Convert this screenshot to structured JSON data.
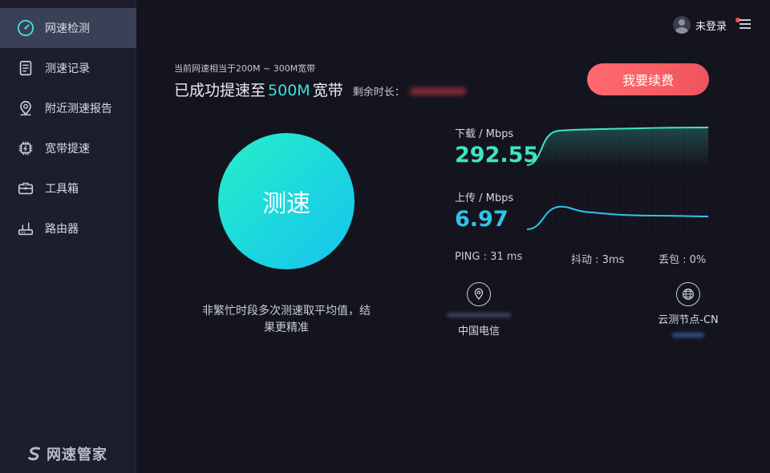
{
  "sidebar": {
    "items": [
      {
        "label": "网速检测",
        "icon": "speedometer-icon",
        "active": true
      },
      {
        "label": "测速记录",
        "icon": "document-icon"
      },
      {
        "label": "附近测速报告",
        "icon": "location-pin-icon"
      },
      {
        "label": "宽带提速",
        "icon": "chip-icon"
      },
      {
        "label": "工具箱",
        "icon": "toolbox-icon"
      },
      {
        "label": "路由器",
        "icon": "router-icon"
      }
    ],
    "brand": "网速管家"
  },
  "header": {
    "user_label": "未登录",
    "menu_icon": "hamburger-menu-icon"
  },
  "info": {
    "current_speed_text": "当前网速相当于200M ~ 300M宽带",
    "headline_prefix": "已成功提速至",
    "headline_highlight": "500M",
    "headline_suffix": "宽带",
    "remaining_label": "剩余时长："
  },
  "renew_button": "我要续费",
  "speed_test_button": "测速",
  "tip": "非繁忙时段多次测速取平均值，结果更精准",
  "download": {
    "label": "下载 / Mbps",
    "value": "292.55",
    "color": "#3de6c0"
  },
  "upload": {
    "label": "上传 / Mbps",
    "value": "6.97",
    "color": "#2ec5e8"
  },
  "stats": {
    "ping": "PING : 31 ms",
    "jitter": "抖动 : 3ms",
    "packet_loss": "丢包 : 0%"
  },
  "isp": {
    "name": "中国电信",
    "icon": "location-pin-icon"
  },
  "node": {
    "name": "云测节点-CN",
    "icon": "globe-icon"
  },
  "colors": {
    "accent": "#3de2d6",
    "renew": "#f0545c",
    "sidebar_bg": "#1c1e2d",
    "active_bg": "#3a4157"
  }
}
